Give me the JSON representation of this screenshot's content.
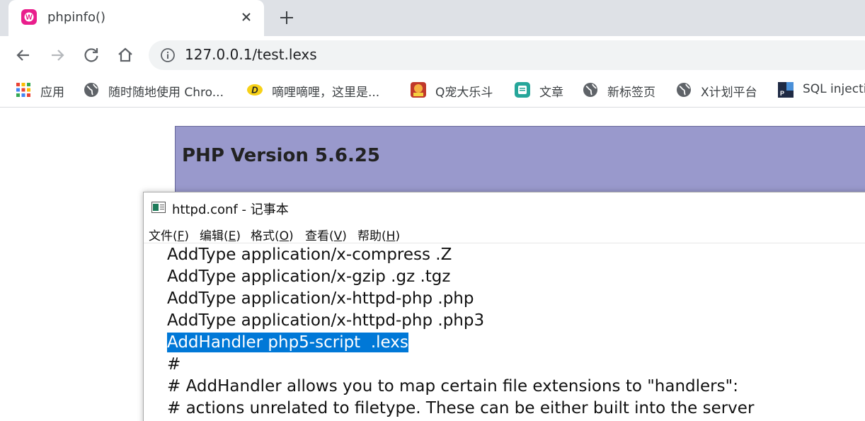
{
  "browser": {
    "tab": {
      "title": "phpinfo()"
    },
    "address": {
      "url": "127.0.0.1/test.lexs"
    },
    "bookmarks": [
      {
        "label": "应用",
        "icon": "apps-grid-icon"
      },
      {
        "label": "随时随地使用 Chro...",
        "icon": "globe-icon"
      },
      {
        "label": "嘀哩嘀哩，这里是...",
        "icon": "dilidili-logo-icon"
      },
      {
        "label": "Q宠大乐斗",
        "icon": "game-icon"
      },
      {
        "label": "文章",
        "icon": "news-icon"
      },
      {
        "label": "新标签页",
        "icon": "globe-icon"
      },
      {
        "label": "X计划平台",
        "icon": "globe-icon"
      },
      {
        "label": "SQL injection",
        "icon": "document-p-icon"
      }
    ]
  },
  "page": {
    "php_title": "PHP Version 5.6.25"
  },
  "notepad": {
    "title": "httpd.conf - 记事本",
    "menu": [
      {
        "text": "文件(",
        "key": "F",
        "end": ")"
      },
      {
        "text": "编辑(",
        "key": "E",
        "end": ")"
      },
      {
        "text": "格式(",
        "key": "O",
        "end": ")"
      },
      {
        "text": "查看(",
        "key": "V",
        "end": ")"
      },
      {
        "text": "帮助(",
        "key": "H",
        "end": ")"
      }
    ],
    "lines": [
      "AddType application/x-compress .Z",
      "AddType application/x-gzip .gz .tgz",
      "AddType application/x-httpd-php .php",
      "AddType application/x-httpd-php .php3",
      "AddHandler php5-script  .lexs",
      "#",
      "# AddHandler allows you to map certain file extensions to \"handlers\":",
      "# actions unrelated to filetype. These can be either built into the server"
    ],
    "selected_line": 4,
    "selection_color": "#0078d7"
  },
  "colors": {
    "tabstrip": "#dee1e6",
    "omnibox": "#f1f3f4",
    "php_header": "#9999cc",
    "favicon": "#e91e8c"
  }
}
